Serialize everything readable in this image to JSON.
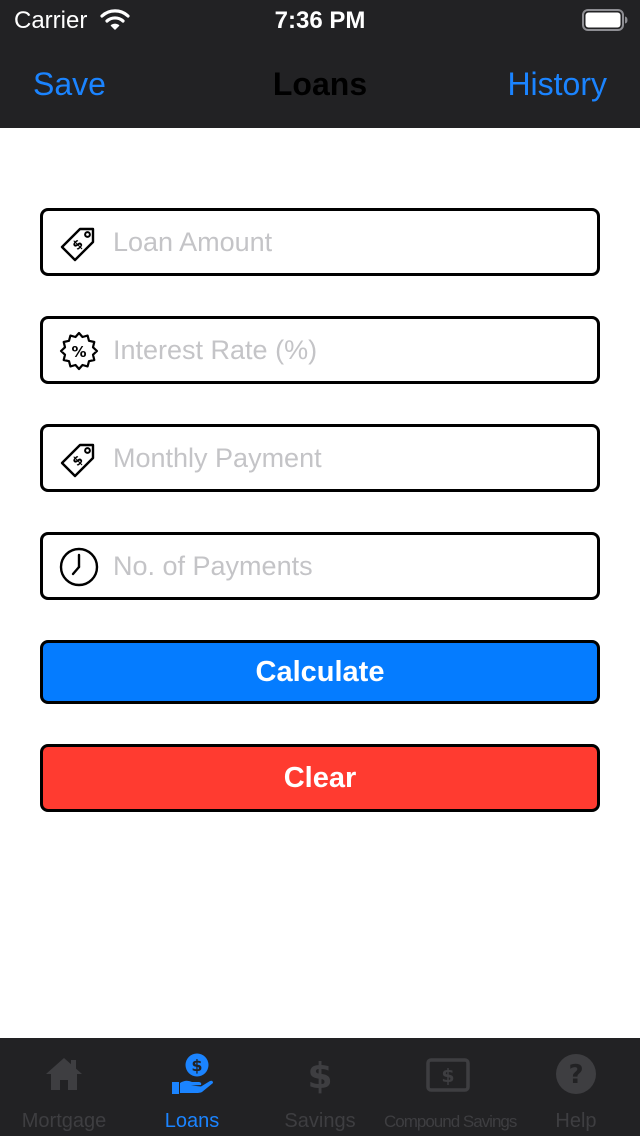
{
  "status_bar": {
    "carrier": "Carrier",
    "time": "7:36 PM"
  },
  "nav": {
    "left_label": "Save",
    "title": "Loans",
    "right_label": "History"
  },
  "form": {
    "loan_amount_placeholder": "Loan Amount",
    "interest_rate_placeholder": "Interest Rate (%)",
    "monthly_payment_placeholder": "Monthly Payment",
    "num_payments_placeholder": "No. of Payments",
    "loan_amount_icon": "price-tag-icon",
    "interest_rate_icon": "percent-badge-icon",
    "monthly_payment_icon": "price-tag-icon",
    "num_payments_icon": "clock-icon"
  },
  "buttons": {
    "calculate_label": "Calculate",
    "clear_label": "Clear"
  },
  "tabs": [
    {
      "label": "Mortgage",
      "icon": "house-icon",
      "active": false
    },
    {
      "label": "Loans",
      "icon": "hand-coin-icon",
      "active": true
    },
    {
      "label": "Savings",
      "icon": "dollar-icon",
      "active": false
    },
    {
      "label": "Compound Savings",
      "icon": "banknote-icon",
      "active": false
    },
    {
      "label": "Help",
      "icon": "question-icon",
      "active": false
    }
  ],
  "colors": {
    "accent": "#1b84ff",
    "calculate_bg": "#057cff",
    "clear_bg": "#ff3b30",
    "bar_bg": "#222224",
    "inactive_tab": "#3e3e41",
    "placeholder": "#c4c4c7"
  }
}
